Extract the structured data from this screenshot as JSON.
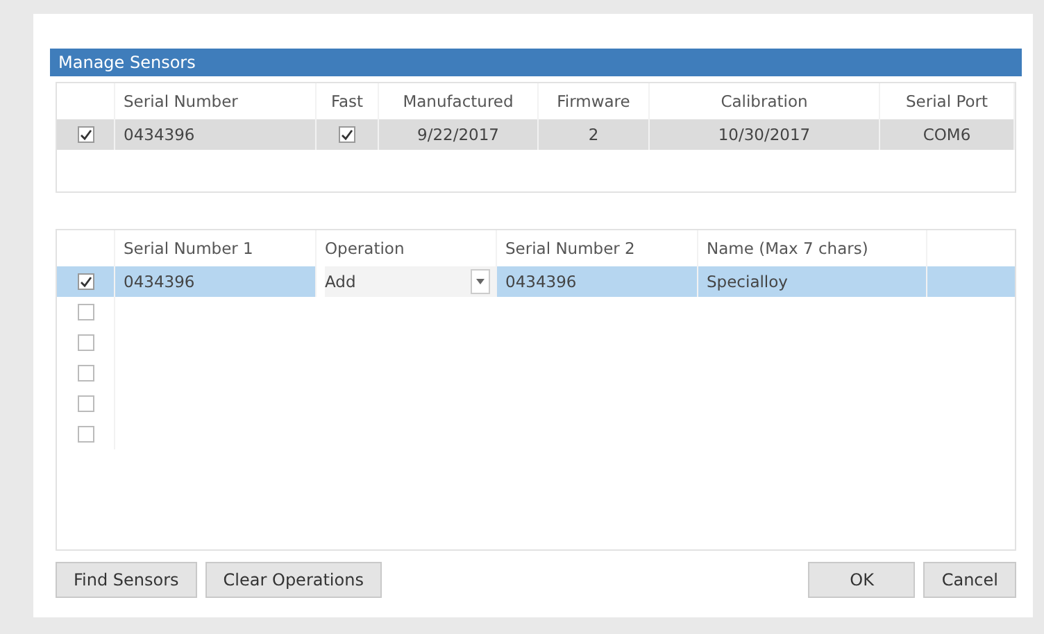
{
  "window": {
    "title": "Manage Sensors"
  },
  "sensors": {
    "columns": [
      "Serial Number",
      "Fast",
      "Manufactured",
      "Firmware",
      "Calibration",
      "Serial Port"
    ],
    "rows": [
      {
        "checked": true,
        "selected": true,
        "serial_number": "0434396",
        "fast": true,
        "manufactured": "9/22/2017",
        "firmware": "2",
        "calibration": "10/30/2017",
        "serial_port": "COM6"
      }
    ]
  },
  "operations": {
    "columns": [
      "Serial Number 1",
      "Operation",
      "Serial Number 2",
      "Name (Max 7 chars)"
    ],
    "rows": [
      {
        "checked": true,
        "selected": true,
        "serial_number_1": "0434396",
        "operation": "Add",
        "serial_number_2": "0434396",
        "name": "Specialloy"
      },
      {
        "checked": false,
        "selected": false
      },
      {
        "checked": false,
        "selected": false
      },
      {
        "checked": false,
        "selected": false
      },
      {
        "checked": false,
        "selected": false
      },
      {
        "checked": false,
        "selected": false
      }
    ]
  },
  "buttons_left": [
    "Find Sensors",
    "Clear Operations"
  ],
  "buttons_right": [
    "OK",
    "Cancel"
  ]
}
